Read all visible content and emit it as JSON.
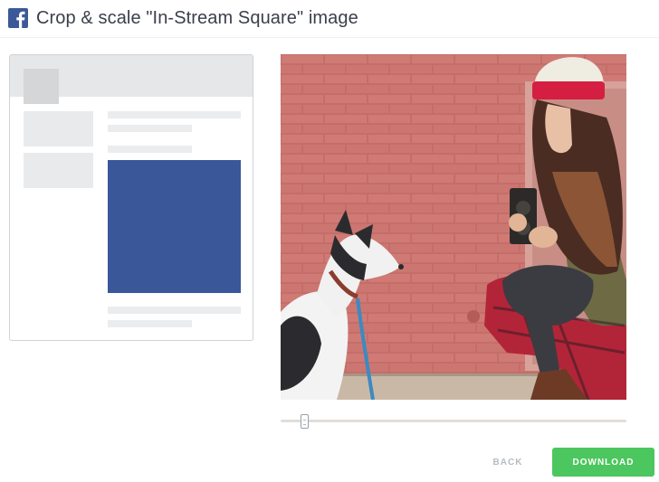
{
  "header": {
    "title": "Crop & scale \"In-Stream Square\" image",
    "icon": "facebook-icon",
    "brand_color": "#3b5998"
  },
  "preview": {
    "accent_color": "#3a579a",
    "placeholder_color": "#e9eaeb"
  },
  "photo": {
    "subject": "image"
  },
  "zoom_slider": {
    "value": 0.06
  },
  "actions": {
    "back_label": "BACK",
    "download_label": "DOWNLOAD",
    "download_color": "#4cc65e"
  }
}
